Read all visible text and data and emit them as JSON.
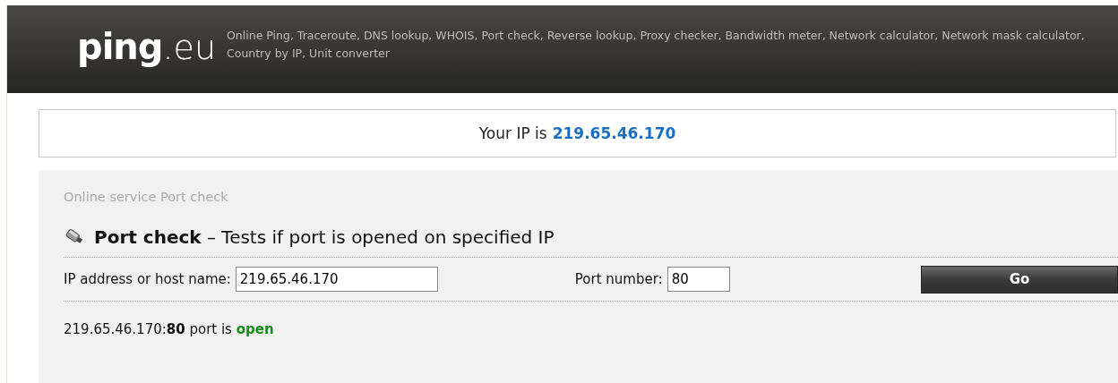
{
  "header": {
    "logo": {
      "name": "ping",
      "suffix": ".eu"
    },
    "tagline": "Online Ping, Traceroute, DNS lookup, WHOIS, Port check, Reverse lookup, Proxy checker, Bandwidth meter, Network calculator, Network mask calculator, Country by IP, Unit converter"
  },
  "ip_banner": {
    "label": "Your IP is",
    "ip": "219.65.46.170"
  },
  "panel": {
    "breadcrumb": "Online service Port check",
    "heading": "**Port check** – Tests if port is opened on specified IP",
    "form": {
      "host_label": "IP address or host name:",
      "host_value": "219.65.46.170",
      "port_label": "Port number:",
      "port_value": "80",
      "submit": "Go"
    },
    "result": {
      "text": "219.65.46.170:**80** port is ",
      "status": "open",
      "port_open": true
    }
  }
}
